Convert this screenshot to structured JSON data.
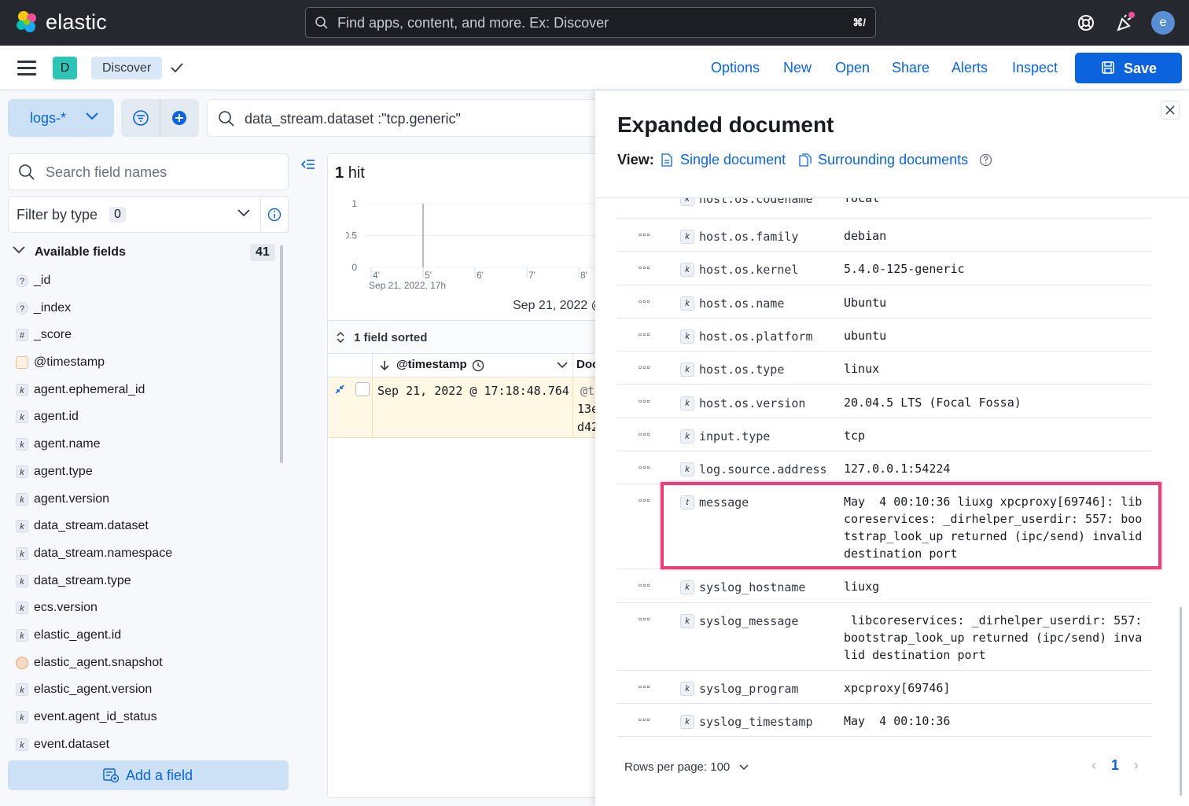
{
  "header": {
    "brand": "elastic",
    "search_placeholder": "Find apps, content, and more. Ex: Discover",
    "search_shortcut": "⌘/",
    "avatar_letter": "e"
  },
  "appbar": {
    "space_letter": "D",
    "breadcrumb": "Discover",
    "nav": [
      "Options",
      "New",
      "Open",
      "Share",
      "Alerts",
      "Inspect"
    ],
    "save_label": "Save"
  },
  "query": {
    "data_view": "logs-*",
    "text": "data_stream.dataset :\"tcp.generic\""
  },
  "sidebar": {
    "search_placeholder": "Search field names",
    "filter_label": "Filter by type",
    "filter_count": "0",
    "available_label": "Available fields",
    "available_count": "41",
    "fields": [
      {
        "name": "_id",
        "type": "?"
      },
      {
        "name": "_index",
        "type": "?"
      },
      {
        "name": "_score",
        "type": "#"
      },
      {
        "name": "@timestamp",
        "type": "date"
      },
      {
        "name": "agent.ephemeral_id",
        "type": "k"
      },
      {
        "name": "agent.id",
        "type": "k"
      },
      {
        "name": "agent.name",
        "type": "k"
      },
      {
        "name": "agent.type",
        "type": "k"
      },
      {
        "name": "agent.version",
        "type": "k"
      },
      {
        "name": "data_stream.dataset",
        "type": "k"
      },
      {
        "name": "data_stream.namespace",
        "type": "k"
      },
      {
        "name": "data_stream.type",
        "type": "k"
      },
      {
        "name": "ecs.version",
        "type": "k"
      },
      {
        "name": "elastic_agent.id",
        "type": "k"
      },
      {
        "name": "elastic_agent.snapshot",
        "type": "bool"
      },
      {
        "name": "elastic_agent.version",
        "type": "k"
      },
      {
        "name": "event.agent_id_status",
        "type": "k"
      },
      {
        "name": "event.dataset",
        "type": "k"
      }
    ],
    "add_field_label": "Add a field"
  },
  "main": {
    "hits_count": "1",
    "hits_label": "hit",
    "sorted_label": "1 field sorted",
    "col_timestamp": "@timestamp",
    "col_document": "Doc",
    "row_timestamp": "Sep 21, 2022 @ 17:18:48.764",
    "row_doc_1": "@t",
    "row_doc_2": "13e",
    "row_doc_3": "d42",
    "chart_date_label": "Sep 21, 2022 @"
  },
  "chart_data": {
    "type": "bar",
    "yticks": [
      "1",
      "0.5",
      "0"
    ],
    "xticks": [
      "4'",
      "5'",
      "6'",
      "7'",
      "8'"
    ],
    "x_sublabel": "Sep 21, 2022, 17h",
    "ylim": [
      0,
      1
    ],
    "values": [
      {
        "x": "5'",
        "y": 1
      }
    ]
  },
  "flyout": {
    "title": "Expanded document",
    "view_label": "View:",
    "single_doc": "Single document",
    "surrounding_docs": "Surrounding documents",
    "rows_per_page": "Rows per page: 100",
    "page": "1",
    "rows": [
      {
        "type": "k",
        "name": "host.os.codename",
        "value": "focal"
      },
      {
        "type": "k",
        "name": "host.os.family",
        "value": "debian"
      },
      {
        "type": "k",
        "name": "host.os.kernel",
        "value": "5.4.0-125-generic"
      },
      {
        "type": "k",
        "name": "host.os.name",
        "value": "Ubuntu"
      },
      {
        "type": "k",
        "name": "host.os.platform",
        "value": "ubuntu"
      },
      {
        "type": "k",
        "name": "host.os.type",
        "value": "linux"
      },
      {
        "type": "k",
        "name": "host.os.version",
        "value": "20.04.5 LTS (Focal Fossa)"
      },
      {
        "type": "k",
        "name": "input.type",
        "value": "tcp"
      },
      {
        "type": "k",
        "name": "log.source.address",
        "value": "127.0.0.1:54224"
      },
      {
        "type": "t",
        "name": "message",
        "value": "May  4 00:10:36 liuxg xpcproxy[69746]: libcoreservices: _dirhelper_userdir: 557: bootstrap_look_up returned (ipc/send) invalid destination port"
      },
      {
        "type": "k",
        "name": "syslog_hostname",
        "value": "liuxg"
      },
      {
        "type": "k",
        "name": "syslog_message",
        "value": " libcoreservices: _dirhelper_userdir: 557: bootstrap_look_up returned (ipc/send) invalid destination port"
      },
      {
        "type": "k",
        "name": "syslog_program",
        "value": "xpcproxy[69746]"
      },
      {
        "type": "k",
        "name": "syslog_timestamp",
        "value": "May  4 00:10:36"
      }
    ]
  },
  "colors": {
    "accent": "#0b64dd",
    "header_bg": "#25282f",
    "highlight": "#e8417a",
    "row_highlight": "#fef8e5"
  }
}
